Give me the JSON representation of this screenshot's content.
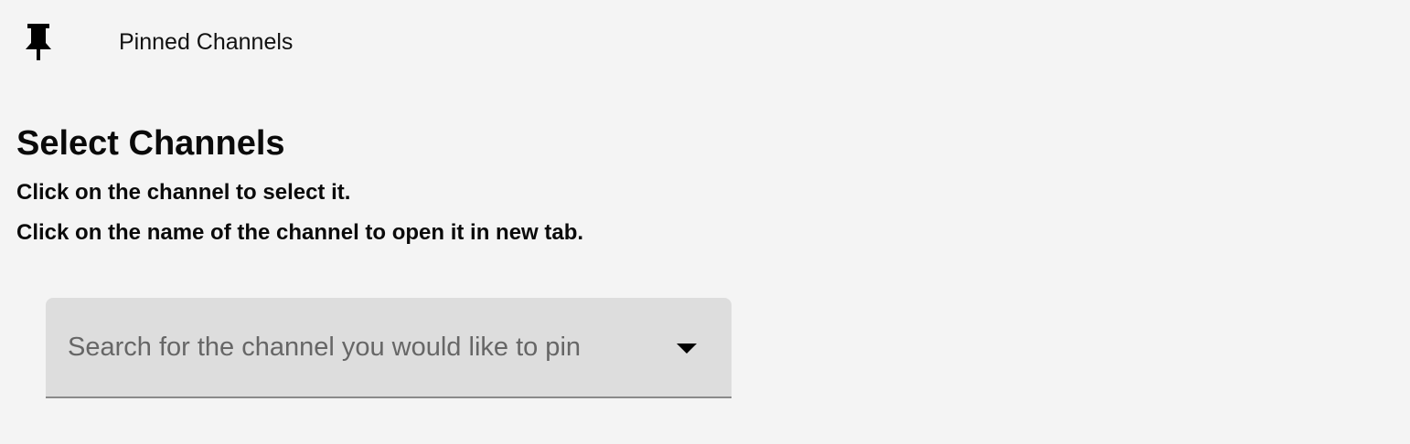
{
  "header": {
    "icon": "pin-icon",
    "title": "Pinned Channels"
  },
  "main": {
    "heading": "Select Channels",
    "instructions": [
      "Click on the channel to select it.",
      "Click on the name of the channel to open it in new tab."
    ],
    "search": {
      "value": "",
      "placeholder": "Search for the channel you would like to pin",
      "dropdown_icon": "arrow-drop-down-icon"
    }
  },
  "colors": {
    "background": "#f4f4f4",
    "field_background": "#dddddd",
    "field_underline": "#8a8a8a",
    "text": "#000000",
    "placeholder": "#666666"
  }
}
